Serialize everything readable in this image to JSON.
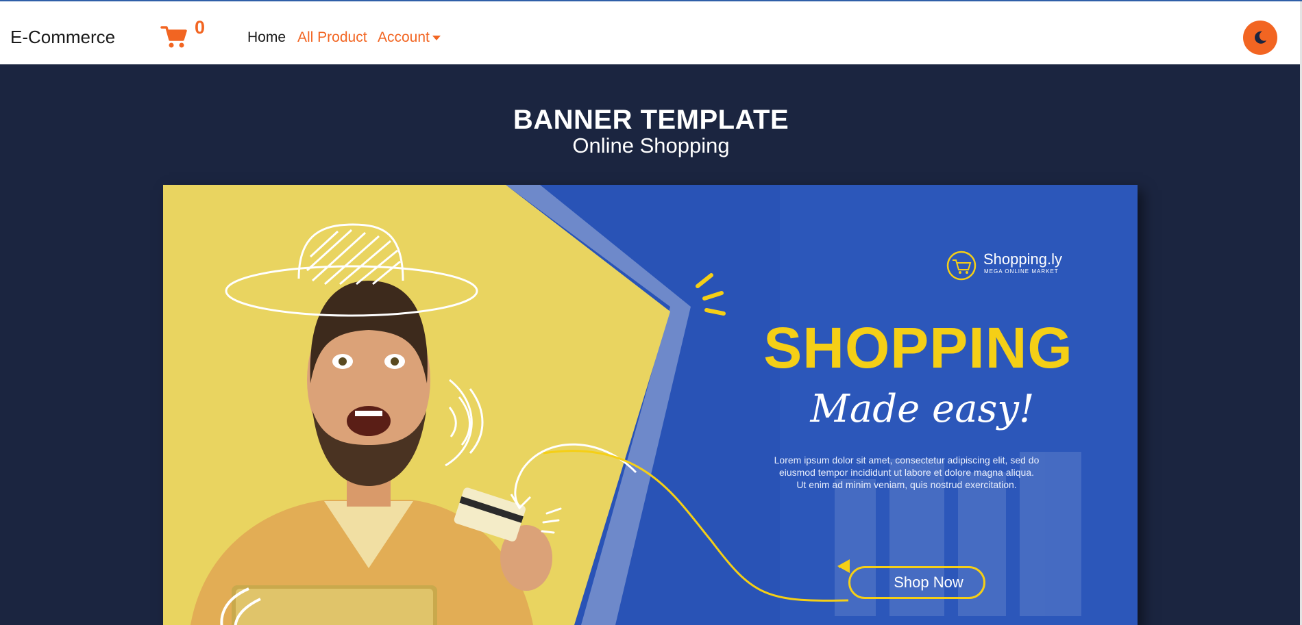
{
  "navbar": {
    "brand": "E-Commerce",
    "cart_count": "0",
    "links": [
      {
        "label": "Home"
      },
      {
        "label": "All Product"
      },
      {
        "label": "Account"
      }
    ]
  },
  "hero": {
    "title": "BANNER TEMPLATE",
    "subtitle": "Online Shopping"
  },
  "banner": {
    "logo_name": "Shopping.ly",
    "logo_tagline": "MEGA ONLINE MARKET",
    "headline": "SHOPPING",
    "script_line": "Made easy!",
    "body_lines": [
      "Lorem ipsum dolor sit amet, consectetur adipiscing elit, sed do",
      "eiusmod tempor incididunt ut labore et dolore magna aliqua.",
      "Ut enim ad minim veniam, quis nostrud exercitation."
    ],
    "cta_label": "Shop Now"
  },
  "icons": {
    "cart": "shopping-cart-icon",
    "theme": "moon-icon",
    "dropdown": "caret-down-icon",
    "logo": "cart-logo-icon",
    "cta_arrow": "arrow-left-icon"
  },
  "colors": {
    "accent": "#f26522",
    "page_bg": "#1b2540",
    "banner_blue": "#2953b6",
    "banner_yellow": "#e9d460",
    "headline_yellow": "#f5cf16"
  }
}
